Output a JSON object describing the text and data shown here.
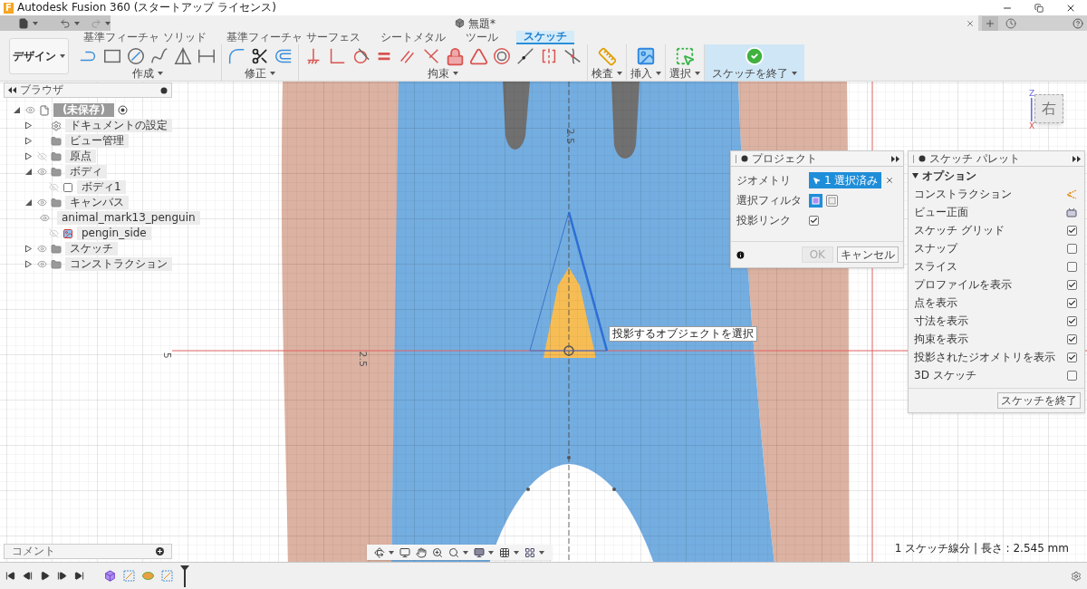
{
  "app": {
    "logo": "F",
    "title": "Autodesk Fusion 360 (スタートアップ ライセンス)"
  },
  "document_tab": {
    "title": "無題*"
  },
  "toolbar": {
    "workspace": "デザイン",
    "tabs": [
      {
        "label": "基準フィーチャ ソリッド",
        "selected": false
      },
      {
        "label": "基準フィーチャ サーフェス",
        "selected": false
      },
      {
        "label": "シートメタル",
        "selected": false
      },
      {
        "label": "ツール",
        "selected": false
      },
      {
        "label": "スケッチ",
        "selected": true
      }
    ],
    "groups": [
      {
        "label": "作成",
        "kind": "create"
      },
      {
        "label": "修正",
        "kind": "modify"
      },
      {
        "label": "拘束",
        "kind": "constraint"
      },
      {
        "label": "検査",
        "kind": "inspect"
      },
      {
        "label": "挿入",
        "kind": "insert"
      },
      {
        "label": "選択",
        "kind": "select"
      },
      {
        "label": "スケッチを終了",
        "kind": "finish"
      }
    ]
  },
  "browser": {
    "title": "ブラウザ",
    "tree": [
      {
        "label": "(未保存)",
        "kind": "document",
        "visible": true,
        "expanded": true,
        "children": [
          {
            "label": "ドキュメントの設定",
            "kind": "settings",
            "expanded": false
          },
          {
            "label": "ビュー管理",
            "kind": "folder",
            "expanded": false
          },
          {
            "label": "原点",
            "kind": "folder",
            "visible": false,
            "expanded": false
          },
          {
            "label": "ボディ",
            "kind": "folder",
            "visible": true,
            "expanded": true,
            "children": [
              {
                "label": "ボディ1",
                "kind": "body",
                "visible": false
              }
            ]
          },
          {
            "label": "キャンバス",
            "kind": "folder",
            "visible": true,
            "expanded": true,
            "children": [
              {
                "label": "animal_mark13_penguin",
                "kind": "image",
                "visible": true
              },
              {
                "label": "pengin_side",
                "kind": "image",
                "visible": false
              }
            ]
          },
          {
            "label": "スケッチ",
            "kind": "folder",
            "visible": true,
            "expanded": false
          },
          {
            "label": "コンストラクション",
            "kind": "folder",
            "visible": true,
            "expanded": false
          }
        ]
      }
    ]
  },
  "comments": {
    "title": "コメント"
  },
  "canvas": {
    "dimension_labels": [
      "2.5",
      "2.5",
      "5"
    ],
    "tooltip": "投影するオブジェクトを選択",
    "view_cube": {
      "face": "右",
      "axes": [
        "Z",
        "X"
      ]
    }
  },
  "project_dialog": {
    "title": "プロジェクト",
    "rows": [
      {
        "kind": "selection",
        "label": "ジオメトリ",
        "value": "1 選択済み"
      },
      {
        "kind": "filter",
        "label": "選択フィルタ",
        "options": [
          {
            "selected": true
          },
          {
            "selected": false
          }
        ]
      },
      {
        "kind": "checkbox",
        "label": "投影リンク",
        "checked": true
      }
    ],
    "buttons": [
      {
        "label": "OK",
        "disabled": true
      },
      {
        "label": "キャンセル",
        "disabled": false
      }
    ]
  },
  "sketch_palette": {
    "title": "スケッチ パレット",
    "section": {
      "label": "オプション",
      "expanded": true
    },
    "options": [
      {
        "label": "コンストラクション",
        "kind": "icon"
      },
      {
        "label": "ビュー正面",
        "kind": "icon"
      },
      {
        "label": "スケッチ グリッド",
        "kind": "checkbox",
        "checked": true
      },
      {
        "label": "スナップ",
        "kind": "checkbox",
        "checked": false
      },
      {
        "label": "スライス",
        "kind": "checkbox",
        "checked": false
      },
      {
        "label": "プロファイルを表示",
        "kind": "checkbox",
        "checked": true
      },
      {
        "label": "点を表示",
        "kind": "checkbox",
        "checked": true
      },
      {
        "label": "寸法を表示",
        "kind": "checkbox",
        "checked": true
      },
      {
        "label": "拘束を表示",
        "kind": "checkbox",
        "checked": true
      },
      {
        "label": "投影されたジオメトリを表示",
        "kind": "checkbox",
        "checked": true
      },
      {
        "label": "3D スケッチ",
        "kind": "checkbox",
        "checked": false
      }
    ],
    "finish_button": "スケッチを終了"
  },
  "status": "1 スケッチ線分 | 長さ : 2.545 mm"
}
